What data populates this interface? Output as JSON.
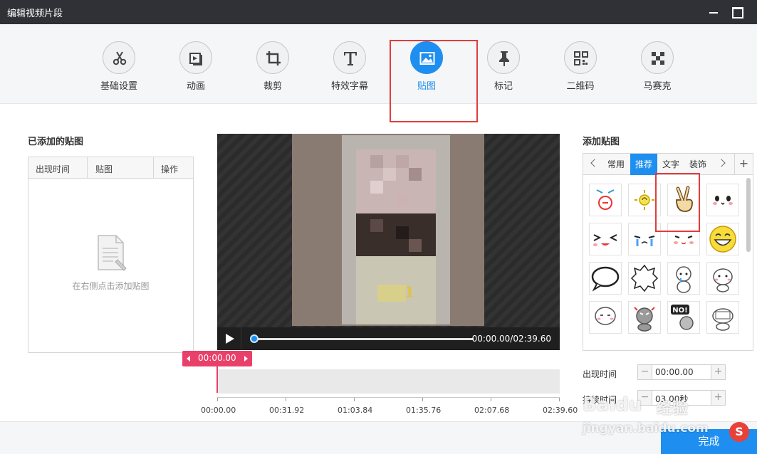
{
  "window": {
    "title": "编辑视频片段"
  },
  "toolbar": {
    "tools": [
      {
        "label": "基础设置",
        "icon": "scissors-icon"
      },
      {
        "label": "动画",
        "icon": "animation-icon"
      },
      {
        "label": "裁剪",
        "icon": "crop-icon"
      },
      {
        "label": "特效字幕",
        "icon": "text-icon"
      },
      {
        "label": "贴图",
        "icon": "image-icon",
        "active": true
      },
      {
        "label": "标记",
        "icon": "pin-icon"
      },
      {
        "label": "二维码",
        "icon": "qrcode-icon"
      },
      {
        "label": "马赛克",
        "icon": "mosaic-icon"
      }
    ]
  },
  "added_panel": {
    "title": "已添加的贴图",
    "columns": [
      "出现时间",
      "贴图",
      "操作"
    ],
    "empty_hint": "在右侧点击添加贴图"
  },
  "player": {
    "overlay_number": "1",
    "time": "00:00.00/02:39.60",
    "progress": 0
  },
  "timeline": {
    "marker": "00:00.00",
    "labels": [
      "00:00.00",
      "00:31.92",
      "01:03.84",
      "01:35.76",
      "02:07.68",
      "02:39.60"
    ]
  },
  "sticker_panel": {
    "title": "添加贴图",
    "tabs": [
      "常用",
      "推荐",
      "文字",
      "装饰"
    ],
    "active_tab": "推荐",
    "plus": "+"
  },
  "fields": {
    "appear_label": "出现时间",
    "appear_value": "00:00.00",
    "duration_label": "持续时间",
    "duration_value": "03.00秒"
  },
  "footer": {
    "done": "完成"
  },
  "watermark": {
    "brand": "Baidu",
    "brand_cn": "经验",
    "url": "jingyan.baidu.com",
    "sogou": "S"
  },
  "colors": {
    "accent": "#1e8ff0",
    "marker": "#e9406a",
    "highlight": "#e23c3c"
  }
}
